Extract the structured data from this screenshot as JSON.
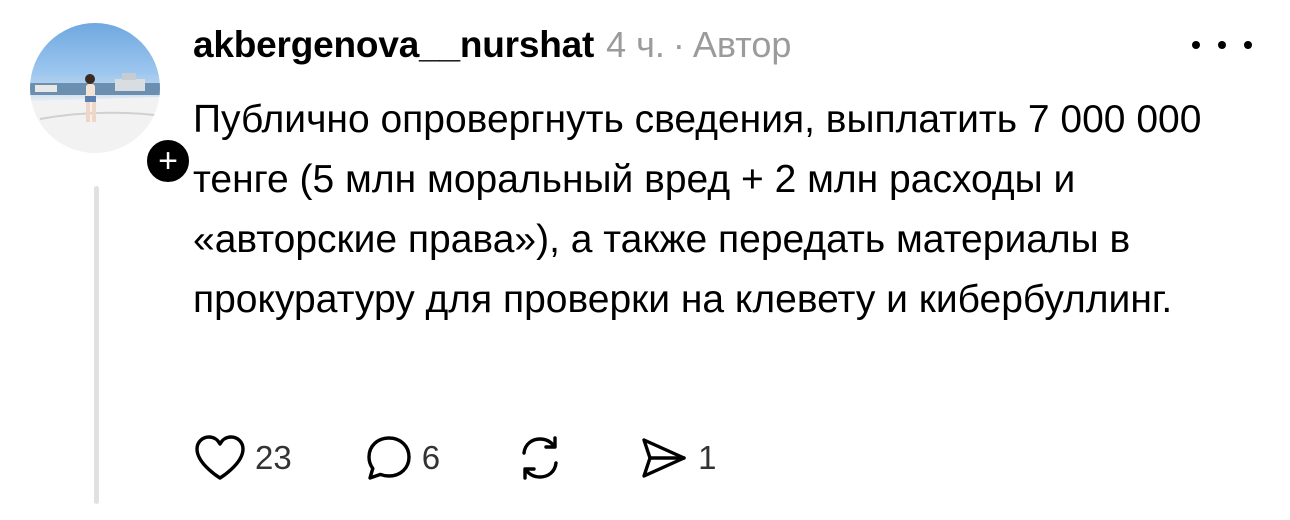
{
  "post": {
    "username": "akbergenova__nurshat",
    "time": "4 ч.",
    "separator": "·",
    "role": "Автор",
    "text": "Публично опровергнуть сведения, выплатить 7 000 000 тенге (5 млн моральный вред + 2 млн расходы и «авторские права»), а также передать материалы в прокуратуру для проверки на клевету и кибербуллинг.",
    "follow_symbol": "+"
  },
  "actions": {
    "likes": "23",
    "comments": "6",
    "reposts": "",
    "shares": "1"
  },
  "icons": {
    "like": "heart-icon",
    "comment": "speech-bubble-icon",
    "repost": "repost-arrows-icon",
    "share": "send-icon",
    "more": "more-dots-icon",
    "follow": "plus-icon"
  },
  "colors": {
    "text": "#000000",
    "muted": "#9b9b9b",
    "thread_line": "#e1e1e1",
    "badge": "#000000"
  }
}
